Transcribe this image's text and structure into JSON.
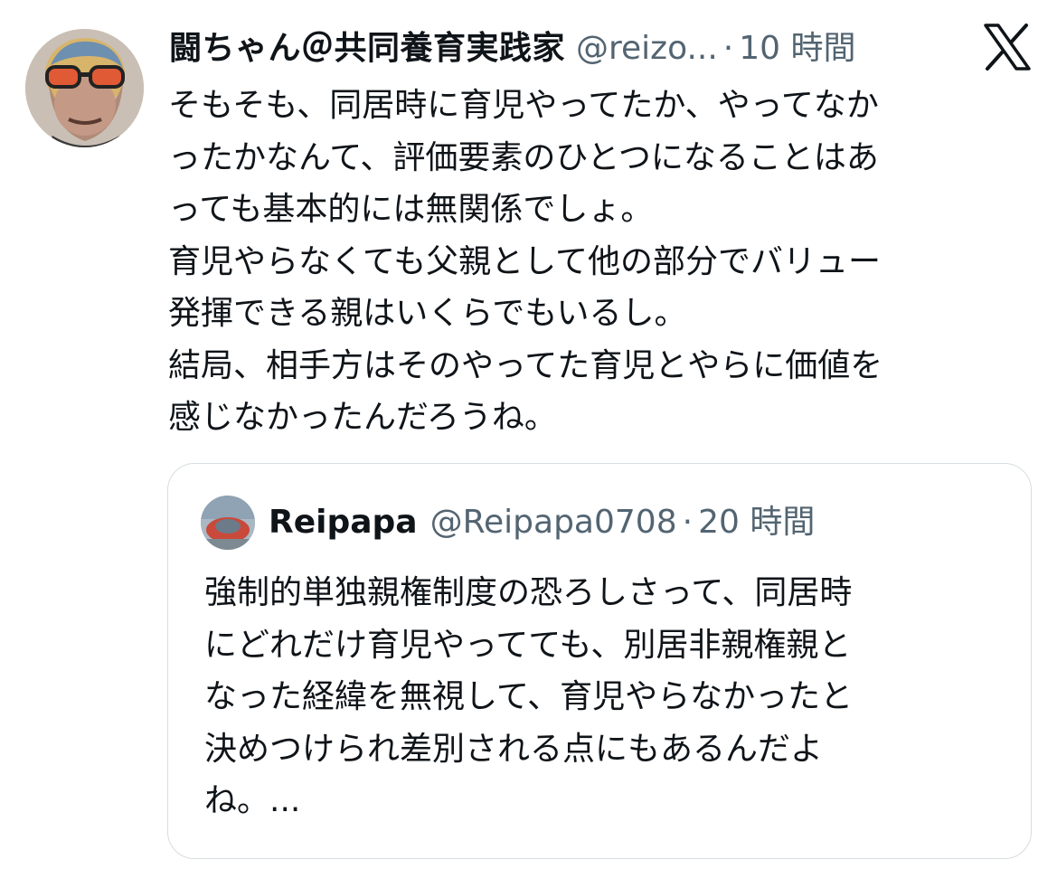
{
  "tweet": {
    "author": {
      "display_name": "闘ちゃん＠共同養育実践家",
      "handle": "@reizo...",
      "separator": "·",
      "time": "10 時間"
    },
    "brand_icon": "x-logo-icon",
    "avatar_icon": "profile-avatar",
    "text_lines": [
      "そもそも、同居時に育児やってたか、やってなか",
      "ったかなんて、評価要素のひとつになることはあ",
      "っても基本的には無関係でしょ。",
      "育児やらなくても父親として他の部分でバリュー",
      "発揮できる親はいくらでもいるし。",
      "結局、相手方はそのやってた育児とやらに価値を",
      "感じなかったんだろうね。"
    ]
  },
  "quoted_tweet": {
    "author": {
      "display_name": "Reipapa",
      "handle": "@Reipapa0708",
      "separator": "·",
      "time": "20 時間"
    },
    "avatar_icon": "quoted-avatar",
    "text_lines": [
      "強制的単独親権制度の恐ろしさって、同居時",
      "にどれだけ育児やってても、別居非親権親と",
      "なった経緯を無視して、育児やらなかったと",
      "決めつけられ差別される点にもあるんだよ",
      "ね。..."
    ]
  },
  "colors": {
    "text_primary": "#0f1419",
    "text_secondary": "#536471",
    "border": "#d7dde1"
  }
}
